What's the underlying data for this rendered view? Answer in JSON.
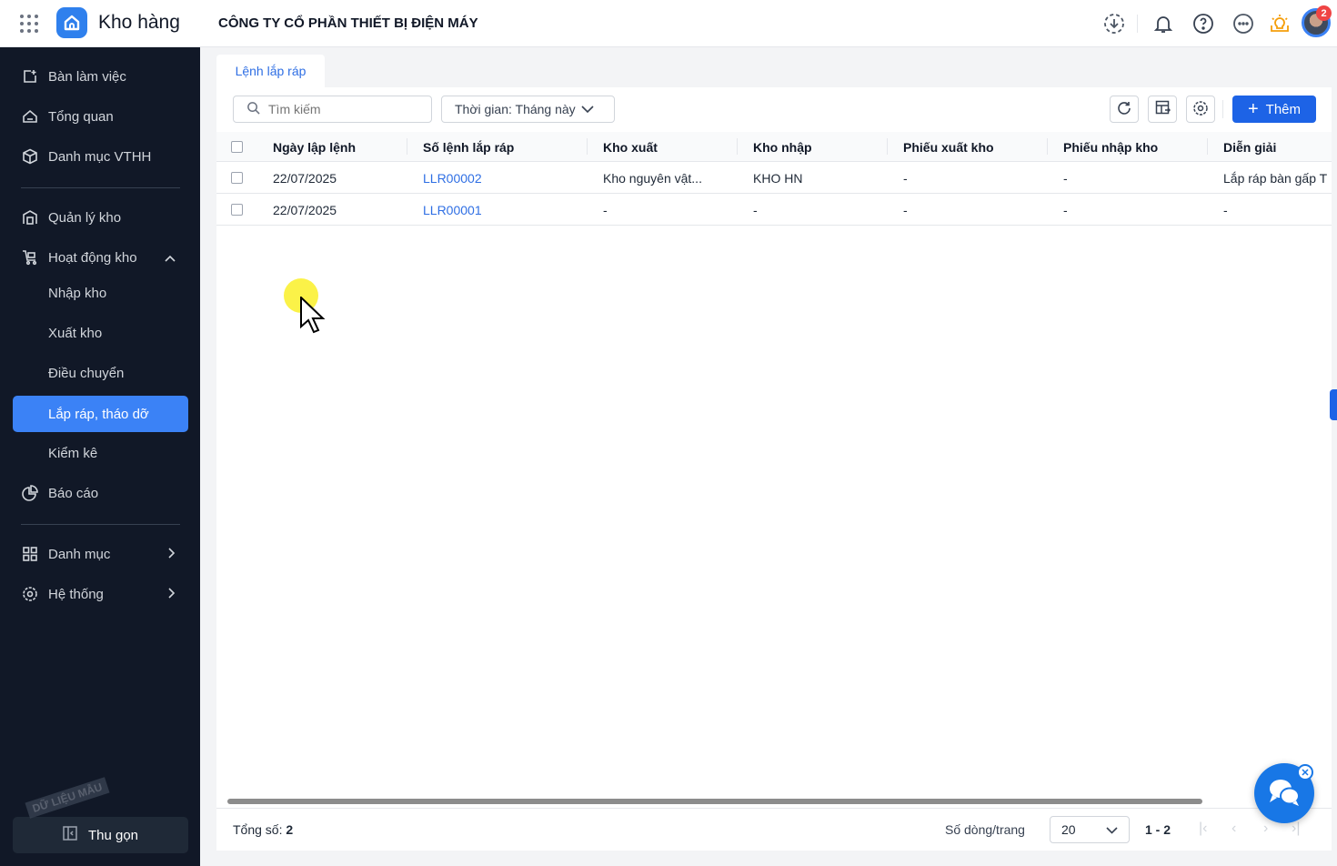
{
  "header": {
    "app_name": "Kho hàng",
    "company": "CÔNG TY CỔ PHẦN THIẾT BỊ ĐIỆN MÁY",
    "notification_count": "2"
  },
  "sidebar": {
    "items": [
      {
        "label": "Bàn làm việc",
        "icon": "dashboard-icon"
      },
      {
        "label": "Tổng quan",
        "icon": "overview-icon"
      },
      {
        "label": "Danh mục VTHH",
        "icon": "box-icon"
      },
      {
        "label": "Quản lý kho",
        "icon": "warehouse-icon"
      },
      {
        "label": "Hoạt động kho",
        "icon": "cart-icon"
      },
      {
        "label": "Nhập kho"
      },
      {
        "label": "Xuất kho"
      },
      {
        "label": "Điều chuyển"
      },
      {
        "label": "Lắp ráp, tháo dỡ",
        "active": true
      },
      {
        "label": "Kiểm kê"
      },
      {
        "label": "Báo cáo",
        "icon": "pie-chart-icon"
      },
      {
        "label": "Danh mục",
        "icon": "grid-icon"
      },
      {
        "label": "Hệ thống",
        "icon": "gear-icon"
      }
    ],
    "collapse_label": "Thu gọn",
    "watermark": "DỮ LIỆU MẪU"
  },
  "tab": {
    "label": "Lệnh lắp ráp"
  },
  "toolbar": {
    "search_placeholder": "Tìm kiếm",
    "filter_label": "Thời gian: Tháng này",
    "add_label": "Thêm"
  },
  "table": {
    "columns": [
      "Ngày lập lệnh",
      "Số lệnh lắp ráp",
      "Kho xuất",
      "Kho nhập",
      "Phiếu xuất kho",
      "Phiếu nhập kho",
      "Diễn giải"
    ],
    "rows": [
      [
        "22/07/2025",
        "LLR00002",
        "Kho nguyên vật...",
        "KHO HN",
        "-",
        "-",
        "Lắp ráp bàn gấp T"
      ],
      [
        "22/07/2025",
        "LLR00001",
        "-",
        "-",
        "-",
        "-",
        "-"
      ]
    ]
  },
  "footer": {
    "total_label": "Tổng số:",
    "total": "2",
    "page_size_label": "Số dòng/trang",
    "page_size": "20",
    "range": "1 - 2"
  }
}
